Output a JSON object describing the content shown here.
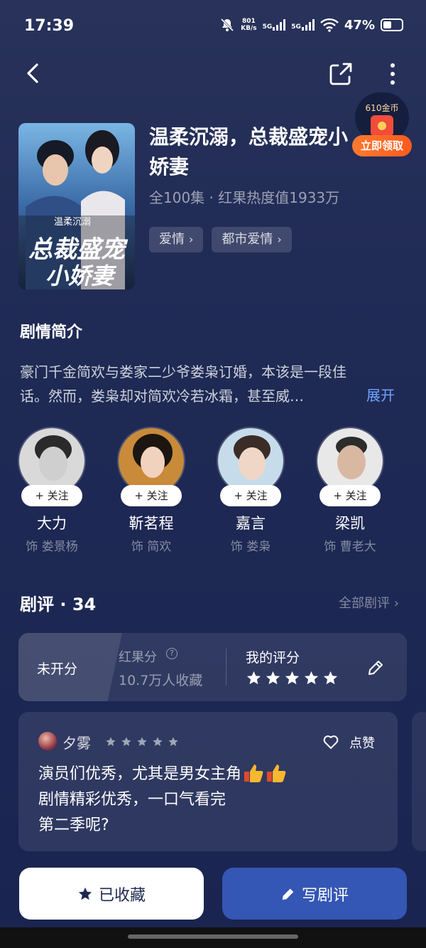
{
  "status_bar": {
    "time": "17:39",
    "net_speed": "801",
    "net_unit": "KB/s",
    "sim1": "5G",
    "sim2": "5G",
    "battery": "47%",
    "battery_level": 0.47
  },
  "nav": {
    "back_icon": "chevron-left-icon",
    "share_icon": "share-icon",
    "more_icon": "more-vertical-icon"
  },
  "coin_reward": {
    "coins": "610金币",
    "claim_label": "立即领取"
  },
  "drama": {
    "poster_title_small": "温柔沉溺",
    "poster_title_main_1": "总裁盛宠",
    "poster_title_main_2": "小娇妻",
    "title": "温柔沉溺，总裁盛宠小娇妻",
    "meta": "全100集 · 红果热度值1933万",
    "tags": [
      "爱情",
      "都市爱情"
    ]
  },
  "synopsis": {
    "heading": "剧情简介",
    "line1": "豪门千金简欢与娄家二少爷娄枭订婚，本该是一段佳",
    "line2": "话。然而，娄枭却对简欢冷若冰霜，甚至威…",
    "expand_label": "展开"
  },
  "cast": {
    "follow_label": "+ 关注",
    "members": [
      {
        "name": "大力",
        "role": "饰 娄景杨"
      },
      {
        "name": "靳茗程",
        "role": "饰 简欢"
      },
      {
        "name": "嘉言",
        "role": "饰 娄枭"
      },
      {
        "name": "梁凯",
        "role": "饰 曹老大"
      }
    ]
  },
  "reviews": {
    "heading": "剧评 · 34",
    "all_label": "全部剧评",
    "score": {
      "unrated": "未开分",
      "hongguo_label": "红果分",
      "collect_count": "10.7万人收藏",
      "my_rating_label": "我的评分",
      "my_stars": 5
    },
    "item": {
      "user": "夕雾",
      "stars": 5,
      "like_label": "点赞",
      "line1": "演员们优秀，尤其是男女主角",
      "line2": "剧情精彩优秀，一口气看完",
      "line3": "第二季呢?"
    }
  },
  "actions": {
    "favorite_label": "已收藏",
    "write_label": "写剧评"
  },
  "colors": {
    "background": "#1f2a55",
    "accent_blue": "#3456b4",
    "link_blue": "#6fa3ff",
    "claim_orange": "#ff6a26"
  }
}
